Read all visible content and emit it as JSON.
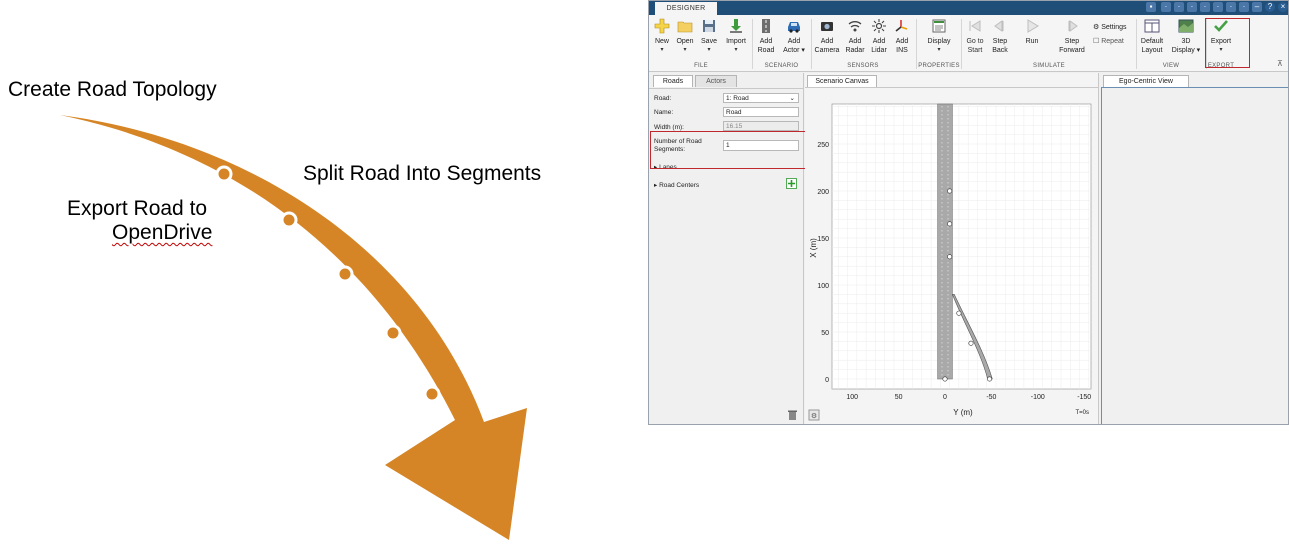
{
  "slide": {
    "step1": "Create Road Topology",
    "step2": "Split Road Into Segments",
    "step3_line1": "Export Road to",
    "step3_line2": "OpenDrive",
    "arrow_color": "#d68526",
    "dot_color": "#d68526"
  },
  "app": {
    "tab": "DESIGNER",
    "toolbar": {
      "file": {
        "label": "FILE",
        "new": "New",
        "open": "Open",
        "save": "Save",
        "import": "Import"
      },
      "scenario": {
        "label": "SCENARIO",
        "add_road_1": "Add",
        "add_road_2": "Road",
        "add_actor_1": "Add",
        "add_actor_2": "Actor"
      },
      "sensors": {
        "label": "SENSORS",
        "camera_1": "Add",
        "camera_2": "Camera",
        "radar_1": "Add",
        "radar_2": "Radar",
        "lidar_1": "Add",
        "lidar_2": "Lidar",
        "ins_1": "Add",
        "ins_2": "INS"
      },
      "properties": {
        "label": "PROPERTIES",
        "display": "Display"
      },
      "simulate": {
        "label": "SIMULATE",
        "go_to_start_1": "Go to",
        "go_to_start_2": "Start",
        "step_back_1": "Step",
        "step_back_2": "Back",
        "run": "Run",
        "step_forward_1": "Step",
        "step_forward_2": "Forward",
        "settings": "Settings",
        "repeat": "Repeat"
      },
      "view": {
        "label": "VIEW",
        "default_layout_1": "Default",
        "default_layout_2": "Layout",
        "display3d_1": "3D",
        "display3d_2": "Display"
      },
      "export": {
        "label": "EXPORT",
        "export": "Export"
      }
    },
    "left_panel": {
      "tab_roads": "Roads",
      "tab_actors": "Actors",
      "road_label": "Road:",
      "road_value": "1: Road",
      "name_label": "Name:",
      "name_value": "Road",
      "width_label": "Width (m):",
      "width_value": "16.15",
      "segments_label_1": "Number of Road",
      "segments_label_2": "Segments:",
      "segments_value": "1",
      "lanes": "Lanes",
      "road_centers": "Road Centers"
    },
    "canvas": {
      "tab": "Scenario Canvas",
      "ylabel": "X (m)",
      "xlabel": "Y (m)",
      "y_ticks": [
        "250",
        "200",
        "150",
        "100",
        "50",
        "0"
      ],
      "x_ticks": [
        "100",
        "50",
        "0",
        "-50",
        "-100",
        "-150"
      ],
      "time": "T=0s"
    },
    "ego": {
      "tab": "Ego-Centric View"
    }
  }
}
